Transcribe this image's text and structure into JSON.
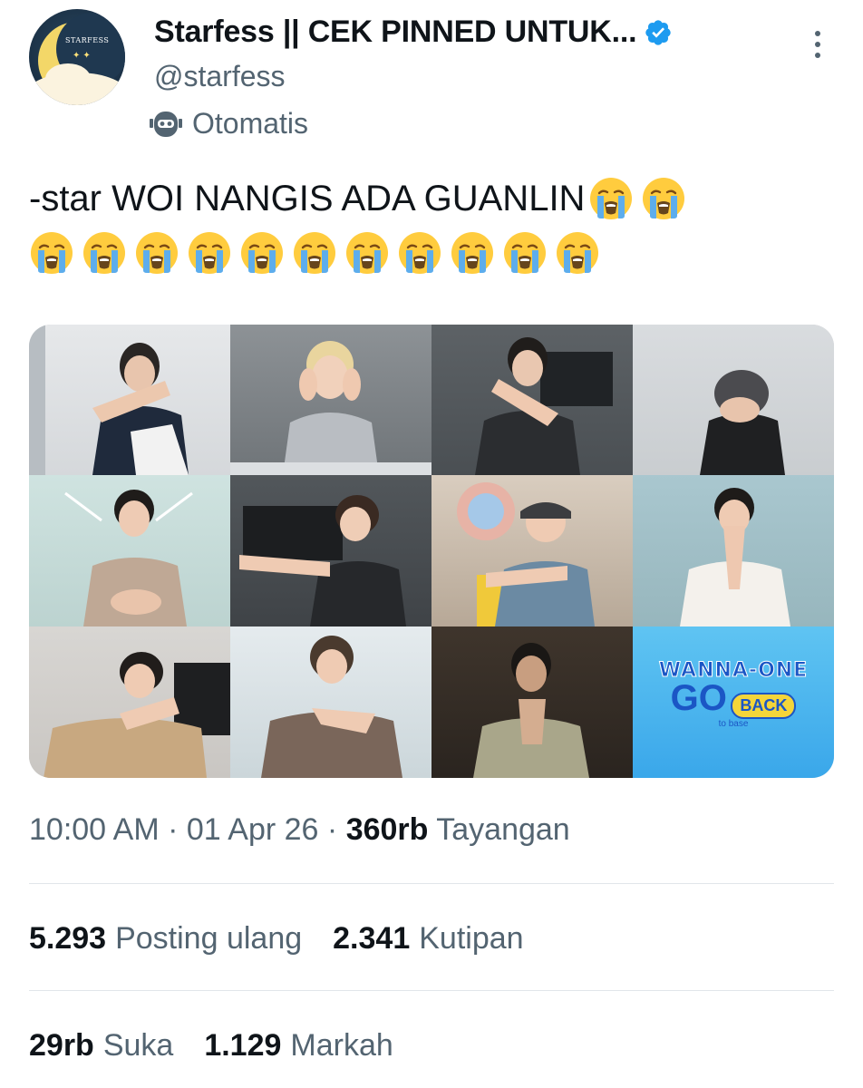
{
  "account": {
    "display_name": "Starfess || CEK PINNED UNTUK...",
    "handle": "@starfess",
    "automated_label": "Otomatis",
    "avatar_brand": "STARFESS",
    "verified_icon": "verified-badge-icon",
    "bot_icon": "robot-icon"
  },
  "tweet": {
    "text": "-star WOI NANGIS ADA GUANLIN",
    "emoji": "loudly-crying-face",
    "emoji_count_line1": 2,
    "emoji_count_line2": 11
  },
  "media": {
    "logo_title": "WANNA-ONE",
    "logo_go": "GO",
    "logo_back": "BACK",
    "logo_sub": "to base"
  },
  "meta": {
    "time": "10:00 AM",
    "separator": "·",
    "date": "01 Apr 26",
    "views_count": "360rb",
    "views_label": "Tayangan"
  },
  "stats": {
    "reposts_count": "5.293",
    "reposts_label": "Posting ulang",
    "quotes_count": "2.341",
    "quotes_label": "Kutipan",
    "likes_count": "29rb",
    "likes_label": "Suka",
    "bookmarks_count": "1.129",
    "bookmarks_label": "Markah"
  },
  "colors": {
    "text_primary": "#0f1419",
    "text_secondary": "#536471",
    "verified_blue": "#1d9bf0",
    "divider": "#e1e6ea"
  }
}
